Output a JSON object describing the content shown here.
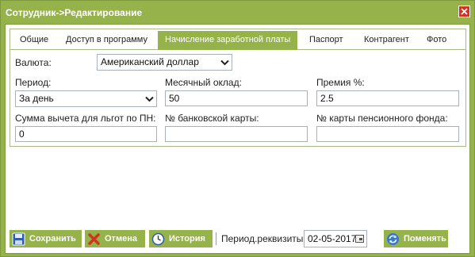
{
  "window": {
    "title": "Сотрудник->Редактирование"
  },
  "tabs": [
    {
      "label": "Общие",
      "active": false
    },
    {
      "label": "Доступ в программу",
      "active": false
    },
    {
      "label": "Начисление заработной платы",
      "active": true
    },
    {
      "label": "Паспорт",
      "active": false
    },
    {
      "label": "Контрагент",
      "active": false
    },
    {
      "label": "Фото",
      "active": false
    }
  ],
  "form": {
    "currency": {
      "label": "Валюта:",
      "value": "Американский доллар"
    },
    "period": {
      "label": "Период:",
      "value": "За день"
    },
    "salary": {
      "label": "Месячный оклад:",
      "value": "50"
    },
    "bonus": {
      "label": "Премия %:",
      "value": "2.5"
    },
    "tax_deduction": {
      "label": "Сумма вычета для льгот по ПН:",
      "value": "0"
    },
    "bank_card": {
      "label": "№ банковской карты:",
      "value": ""
    },
    "pension_card": {
      "label": "№ карты пенсионного фонда:",
      "value": ""
    }
  },
  "footer": {
    "save_label": "Сохранить",
    "cancel_label": "Отмена",
    "history_label": "История",
    "period_label": "Период.реквизиты:",
    "date_value": "02-05-2017",
    "change_label": "Поменять"
  },
  "colors": {
    "accent": "#95b24b",
    "close": "#d9301f",
    "border": "#a9b98a"
  },
  "icons": [
    "close-icon",
    "chevron-down-icon",
    "save-disk-icon",
    "cancel-x-icon",
    "clock-icon",
    "calendar-icon",
    "refresh-icon"
  ]
}
